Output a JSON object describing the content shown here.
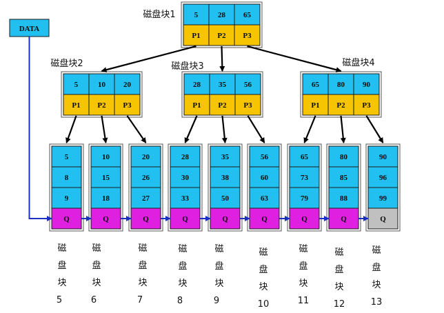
{
  "data_label": "DATA",
  "colors": {
    "key_cell": "#22c0f0",
    "pointer_cell": "#f6c400",
    "q_cell": "#e020e0",
    "q_last_cell": "#c0c0c0",
    "border": "#1a1a1a",
    "link_arrow": "#1a2fbf"
  },
  "root": {
    "title": "磁盘块1",
    "keys": [
      "5",
      "28",
      "65"
    ],
    "pointers": [
      "P1",
      "P2",
      "P3"
    ]
  },
  "internal": [
    {
      "title": "磁盘块2",
      "keys": [
        "5",
        "10",
        "20"
      ],
      "pointers": [
        "P1",
        "P2",
        "P3"
      ]
    },
    {
      "title": "磁盘块3",
      "keys": [
        "28",
        "35",
        "56"
      ],
      "pointers": [
        "P1",
        "P2",
        "P3"
      ]
    },
    {
      "title": "磁盘块4",
      "keys": [
        "65",
        "80",
        "90"
      ],
      "pointers": [
        "P1",
        "P2",
        "P3"
      ]
    }
  ],
  "leaves": [
    {
      "keys": [
        "5",
        "8",
        "9"
      ],
      "q": "Q",
      "label_chars": [
        "磁",
        "盘",
        "块"
      ],
      "label_num": "5"
    },
    {
      "keys": [
        "10",
        "15",
        "18"
      ],
      "q": "Q",
      "label_chars": [
        "磁",
        "盘",
        "块"
      ],
      "label_num": "6"
    },
    {
      "keys": [
        "20",
        "26",
        "27"
      ],
      "q": "Q",
      "label_chars": [
        "磁",
        "盘",
        "块"
      ],
      "label_num": "7"
    },
    {
      "keys": [
        "28",
        "30",
        "33"
      ],
      "q": "Q",
      "label_chars": [
        "磁",
        "盘",
        "块"
      ],
      "label_num": "8"
    },
    {
      "keys": [
        "35",
        "38",
        "50"
      ],
      "q": "Q",
      "label_chars": [
        "磁",
        "盘",
        "块"
      ],
      "label_num": "9"
    },
    {
      "keys": [
        "56",
        "60",
        "63"
      ],
      "q": "Q",
      "label_chars": [
        "磁",
        "盘",
        "块"
      ],
      "label_num": "10"
    },
    {
      "keys": [
        "65",
        "73",
        "79"
      ],
      "q": "Q",
      "label_chars": [
        "磁",
        "盘",
        "块"
      ],
      "label_num": "11"
    },
    {
      "keys": [
        "80",
        "85",
        "88"
      ],
      "q": "Q",
      "label_chars": [
        "磁",
        "盘",
        "块"
      ],
      "label_num": "12"
    },
    {
      "keys": [
        "90",
        "96",
        "99"
      ],
      "q": "Q",
      "label_chars": [
        "磁",
        "盘",
        "块"
      ],
      "label_num": "13"
    }
  ]
}
